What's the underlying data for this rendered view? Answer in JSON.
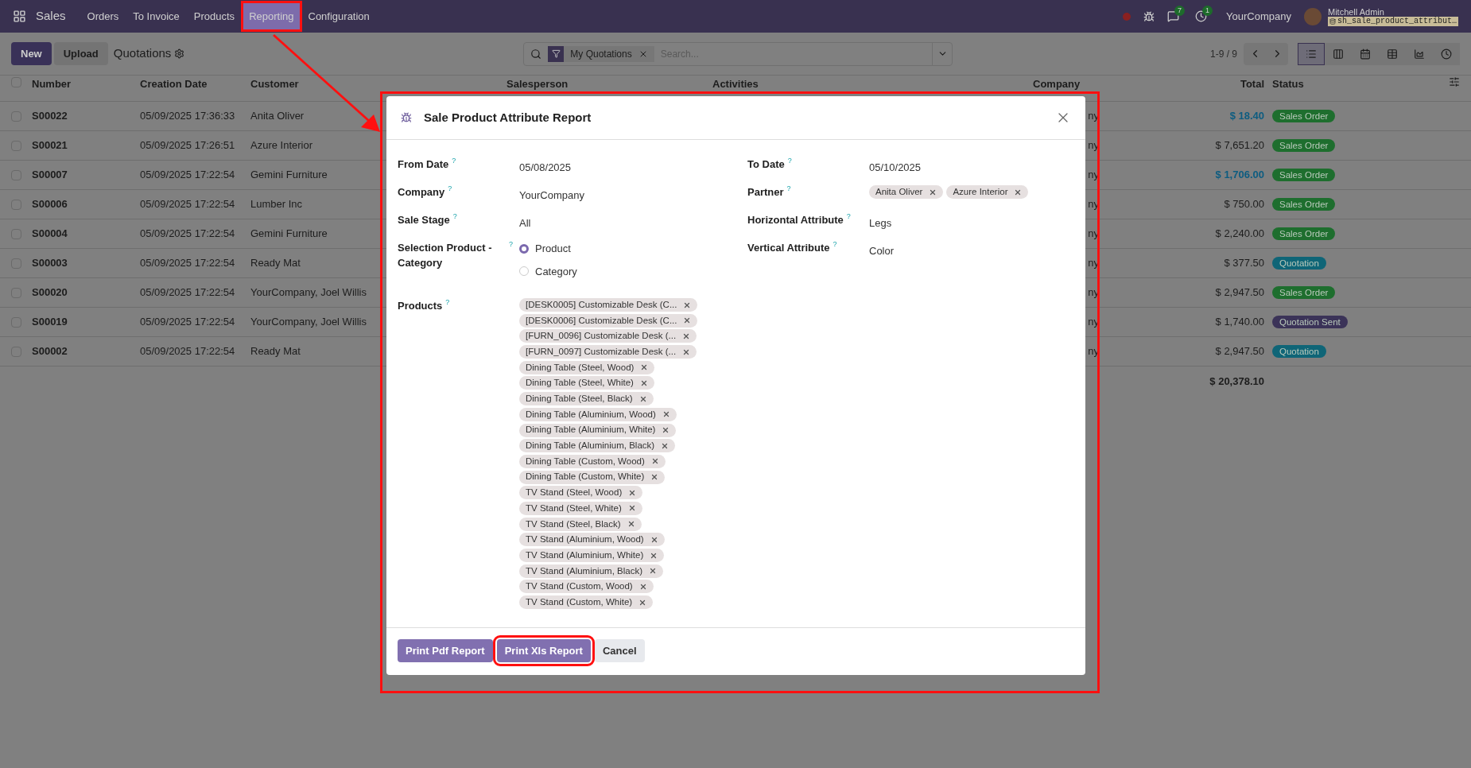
{
  "navbar": {
    "app": "Sales",
    "menu": [
      {
        "label": "Orders",
        "annotated": false
      },
      {
        "label": "To Invoice",
        "annotated": false
      },
      {
        "label": "Products",
        "annotated": false
      },
      {
        "label": "Reporting",
        "annotated": true
      },
      {
        "label": "Configuration",
        "annotated": false
      }
    ],
    "messages_count": "7",
    "activities_count": "1",
    "company": "YourCompany",
    "user": "Mitchell Admin",
    "database": "sh_sale_product_attribut…"
  },
  "control_panel": {
    "buttons": [
      {
        "label": "New",
        "kind": "primary"
      },
      {
        "label": "Upload",
        "kind": "secondary"
      }
    ],
    "title": "Quotations",
    "filter": "My Quotations",
    "search_placeholder": "Search...",
    "pager": "1-9 / 9",
    "views": [
      {
        "kind": "list",
        "selected": true
      },
      {
        "kind": "kanban",
        "selected": false
      },
      {
        "kind": "calendar",
        "selected": false
      },
      {
        "kind": "pivot",
        "selected": false
      },
      {
        "kind": "graph",
        "selected": false
      },
      {
        "kind": "activity",
        "selected": false
      }
    ]
  },
  "table": {
    "select_all_checked": false,
    "columns": [
      "Number",
      "Creation Date",
      "Customer",
      "Salesperson",
      "Activities",
      "Company",
      "Total",
      "Status"
    ],
    "rows": [
      {
        "checked": false,
        "number": "S00022",
        "date": "05/09/2025 17:36:33",
        "customer": "Anita Oliver",
        "company": "ny",
        "total": "$ 18.40",
        "total_highlighted": true,
        "status": {
          "label": "Sales Order",
          "color": "#1e6e2e"
        }
      },
      {
        "checked": false,
        "number": "S00021",
        "date": "05/09/2025 17:26:51",
        "customer": "Azure Interior",
        "company": "ny",
        "total": "$ 7,651.20",
        "total_highlighted": false,
        "status": {
          "label": "Sales Order",
          "color": "#1e6e2e"
        }
      },
      {
        "checked": false,
        "number": "S00007",
        "date": "05/09/2025 17:22:54",
        "customer": "Gemini Furniture",
        "company": "ny",
        "total": "$ 1,706.00",
        "total_highlighted": true,
        "status": {
          "label": "Sales Order",
          "color": "#1e6e2e"
        }
      },
      {
        "checked": false,
        "number": "S00006",
        "date": "05/09/2025 17:22:54",
        "customer": "Lumber Inc",
        "company": "ny",
        "total": "$ 750.00",
        "total_highlighted": false,
        "status": {
          "label": "Sales Order",
          "color": "#1e6e2e"
        }
      },
      {
        "checked": false,
        "number": "S00004",
        "date": "05/09/2025 17:22:54",
        "customer": "Gemini Furniture",
        "company": "ny",
        "total": "$ 2,240.00",
        "total_highlighted": false,
        "status": {
          "label": "Sales Order",
          "color": "#1e6e2e"
        }
      },
      {
        "checked": false,
        "number": "S00003",
        "date": "05/09/2025 17:22:54",
        "customer": "Ready Mat",
        "company": "ny",
        "total": "$ 377.50",
        "total_highlighted": false,
        "status": {
          "label": "Quotation",
          "color": "#0f6577"
        }
      },
      {
        "checked": false,
        "number": "S00020",
        "date": "05/09/2025 17:22:54",
        "customer": "YourCompany, Joel Willis",
        "company": "ny",
        "total": "$ 2,947.50",
        "total_highlighted": false,
        "status": {
          "label": "Sales Order",
          "color": "#1e6e2e"
        }
      },
      {
        "checked": false,
        "number": "S00019",
        "date": "05/09/2025 17:22:54",
        "customer": "YourCompany, Joel Willis",
        "company": "ny",
        "total": "$ 1,740.00",
        "total_highlighted": false,
        "status": {
          "label": "Quotation Sent",
          "color": "#3b3358"
        }
      },
      {
        "checked": false,
        "number": "S00002",
        "date": "05/09/2025 17:22:54",
        "customer": "Ready Mat",
        "company": "ny",
        "total": "$ 2,947.50",
        "total_highlighted": false,
        "status": {
          "label": "Quotation",
          "color": "#0f6577"
        }
      }
    ],
    "sum_total": "$ 20,378.10"
  },
  "dialog": {
    "title": "Sale Product Attribute Report",
    "left_fields": [
      {
        "label": "From Date",
        "kind": "text",
        "value": "05/08/2025"
      },
      {
        "label": "Company",
        "kind": "text",
        "value": "YourCompany"
      },
      {
        "label": "Sale Stage",
        "kind": "text",
        "value": "All"
      },
      {
        "label": "Selection Product - Category",
        "kind": "radio",
        "options": [
          {
            "label": "Product",
            "selected": true
          },
          {
            "label": "Category",
            "selected": false
          }
        ]
      }
    ],
    "right_fields": [
      {
        "label": "To Date",
        "kind": "text",
        "value": "05/10/2025"
      },
      {
        "label": "Partner",
        "kind": "tags",
        "tags": [
          "Anita Oliver",
          "Azure Interior"
        ]
      },
      {
        "label": "Horizontal Attribute",
        "kind": "text",
        "value": "Legs"
      },
      {
        "label": "Vertical Attribute",
        "kind": "text",
        "value": "Color"
      }
    ],
    "products": {
      "label": "Products",
      "tags": [
        "[DESK0005] Customizable Desk (C...",
        "[DESK0006] Customizable Desk (C...",
        "[FURN_0096] Customizable Desk (...",
        "[FURN_0097] Customizable Desk (...",
        "Dining Table (Steel, Wood)",
        "Dining Table (Steel, White)",
        "Dining Table (Steel, Black)",
        "Dining Table (Aluminium, Wood)",
        "Dining Table (Aluminium, White)",
        "Dining Table (Aluminium, Black)",
        "Dining Table (Custom, Wood)",
        "Dining Table (Custom, White)",
        "TV Stand (Steel, Wood)",
        "TV Stand (Steel, White)",
        "TV Stand (Steel, Black)",
        "TV Stand (Aluminium, Wood)",
        "TV Stand (Aluminium, White)",
        "TV Stand (Aluminium, Black)",
        "TV Stand (Custom, Wood)",
        "TV Stand (Custom, White)"
      ]
    },
    "help_mark": "?",
    "buttons": [
      {
        "label": "Print Pdf Report",
        "kind": "primary",
        "annotated": false
      },
      {
        "label": "Print Xls Report",
        "kind": "primary",
        "annotated": true
      },
      {
        "label": "Cancel",
        "kind": "secondary",
        "annotated": false
      }
    ]
  }
}
